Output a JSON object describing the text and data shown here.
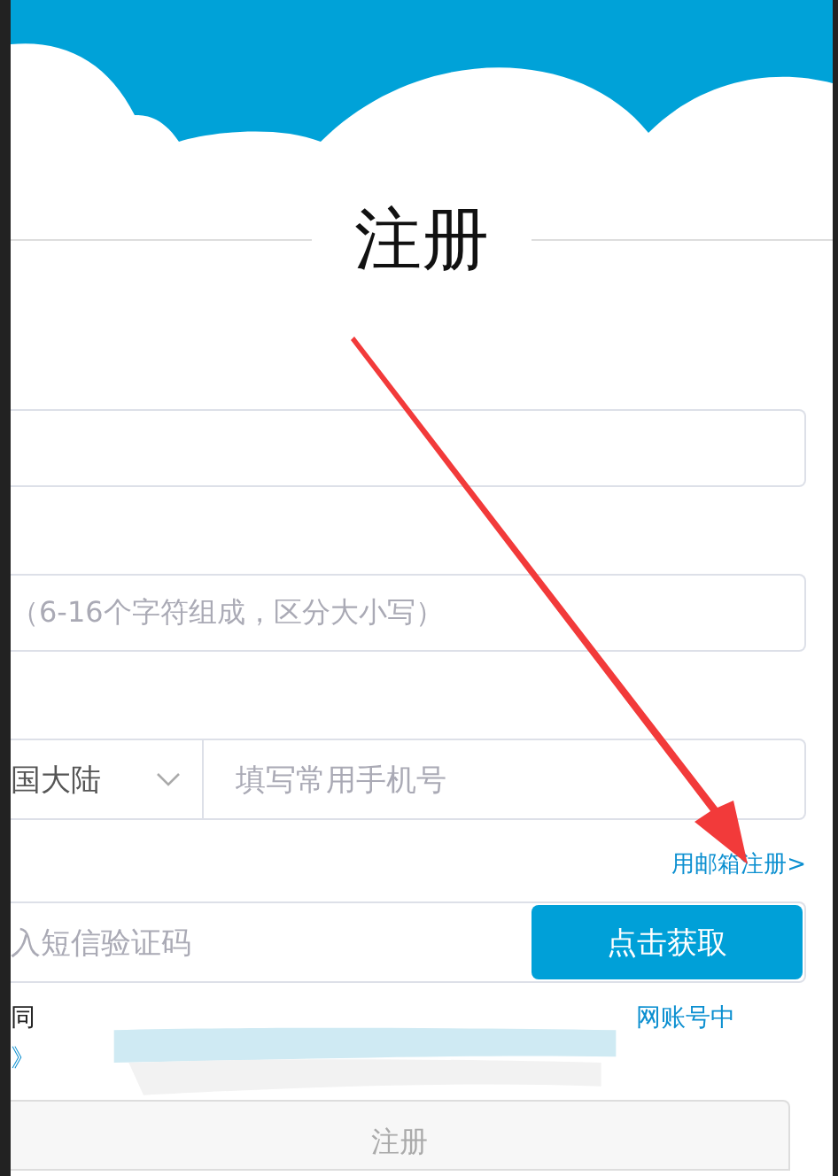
{
  "title": "注册",
  "fields": [
    {
      "kind": "text"
    },
    {
      "kind": "text",
      "placeholder": "（6-16个字符组成，区分大小写）"
    }
  ],
  "phone": {
    "region": "国大陆",
    "placeholder": "填写常用手机号"
  },
  "email_link": "用邮箱注册>",
  "sms": {
    "placeholder": "入短信验证码",
    "button": "点击获取"
  },
  "agreement": {
    "text": "同",
    "link": "网账号中",
    "link2": "》"
  },
  "submit": "注册"
}
